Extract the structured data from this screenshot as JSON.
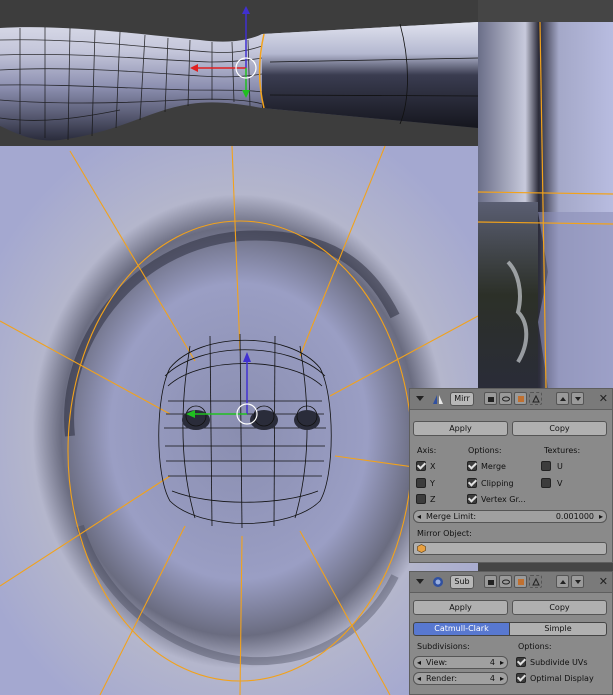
{
  "mirror_modifier": {
    "name": "Mirr",
    "apply_label": "Apply",
    "copy_label": "Copy",
    "axis_heading": "Axis:",
    "options_heading": "Options:",
    "textures_heading": "Textures:",
    "axis": [
      {
        "label": "X",
        "checked": true
      },
      {
        "label": "Y",
        "checked": false
      },
      {
        "label": "Z",
        "checked": false
      }
    ],
    "options": [
      {
        "label": "Merge",
        "checked": true
      },
      {
        "label": "Clipping",
        "checked": true
      },
      {
        "label": "Vertex Gr...",
        "checked": true
      }
    ],
    "textures": [
      {
        "label": "U",
        "checked": false
      },
      {
        "label": "V",
        "checked": false
      }
    ],
    "merge_limit_label": "Merge Limit:",
    "merge_limit_value": "0.001000",
    "mirror_object_label": "Mirror Object:"
  },
  "subsurf_modifier": {
    "name": "Sub",
    "apply_label": "Apply",
    "copy_label": "Copy",
    "tabs": [
      "Catmull-Clark",
      "Simple"
    ],
    "active_tab": "Catmull-Clark",
    "subdivisions_heading": "Subdivisions:",
    "options_heading": "Options:",
    "view_label": "View:",
    "view_value": "4",
    "render_label": "Render:",
    "render_value": "4",
    "subdivide_uvs_label": "Subdivide UVs",
    "subdivide_uvs_checked": true,
    "optimal_display_label": "Optimal Display",
    "optimal_display_checked": true
  },
  "colors": {
    "mesh_surface": "#aab0d8",
    "selection_edge": "#f2a21b",
    "wire": "#111111",
    "axis_x": "#e02020",
    "axis_y": "#20c020",
    "axis_z": "#4030d0",
    "panel_bg": "#8a8a8a",
    "active_tab": "#5878d0"
  }
}
